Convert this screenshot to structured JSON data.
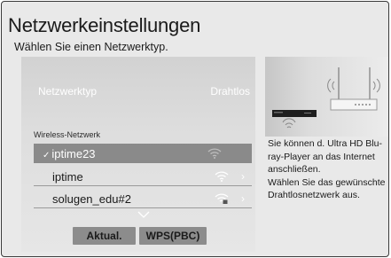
{
  "header": {
    "title": "Netzwerkeinstellungen",
    "subtitle": "Wählen Sie einen Netzwerktyp."
  },
  "network_type": {
    "label": "Netzwerktyp",
    "value": "Drahtlos"
  },
  "wireless": {
    "section_label": "Wireless-Netzwerk",
    "networks": [
      {
        "name": "iptime23",
        "selected": true,
        "check": "✓",
        "icon": "wifi-signal-icon",
        "locked": false
      },
      {
        "name": "iptime",
        "selected": false,
        "icon": "wifi-signal-icon",
        "locked": false
      },
      {
        "name": "solugen_edu#2",
        "selected": false,
        "icon": "wifi-locked-signal-icon",
        "locked": true
      }
    ]
  },
  "buttons": {
    "refresh": "Aktual.",
    "wps": "WPS(PBC)"
  },
  "info": {
    "line1": "Sie können d. Ultra HD Blu-ray-Player an das Internet anschließen.",
    "line2": "Wählen Sie das gewünschte Drahtlosnetzwerk aus."
  },
  "colors": {
    "panel_bg": "#e9e9e9",
    "selected_row": "#8a8a8a",
    "button_bg": "#8c8c8c"
  }
}
